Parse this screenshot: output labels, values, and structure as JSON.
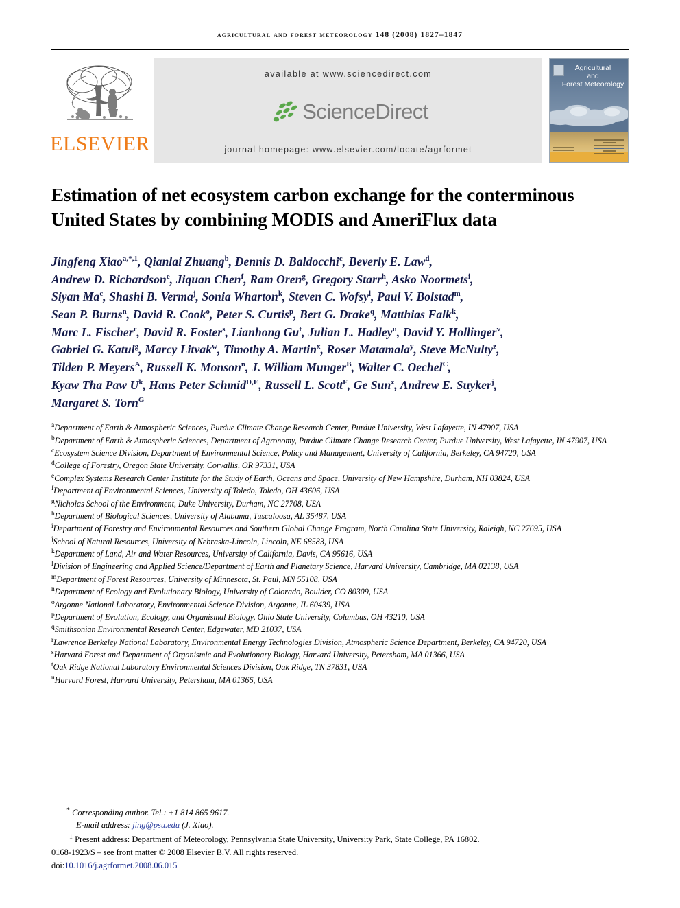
{
  "running_head": "Agricultural and Forest Meteorology 148 (2008) 1827–1847",
  "header": {
    "publisher_name": "ELSEVIER",
    "publisher_logo_icon": "elsevier-tree-icon",
    "available_at": "available at www.sciencedirect.com",
    "sciencedirect_wordmark": "ScienceDirect",
    "sciencedirect_leaves_icon": "sciencedirect-leaves-icon",
    "journal_homepage": "journal homepage: www.elsevier.com/locate/agrformet",
    "cover": {
      "line1": "Agricultural",
      "line2": "and",
      "line3": "Forest Meteorology",
      "badge_icon": "journal-emblem-icon"
    }
  },
  "article": {
    "title": "Estimation of net ecosystem carbon exchange for the conterminous United States by combining MODIS and AmeriFlux data",
    "author_lines": [
      [
        {
          "name": "Jingfeng Xiao",
          "sup": "a,*,1"
        },
        {
          "name": "Qianlai Zhuang",
          "sup": "b"
        },
        {
          "name": "Dennis D. Baldocchi",
          "sup": "c"
        },
        {
          "name": "Beverly E. Law",
          "sup": "d"
        }
      ],
      [
        {
          "name": "Andrew D. Richardson",
          "sup": "e"
        },
        {
          "name": "Jiquan Chen",
          "sup": "f"
        },
        {
          "name": "Ram Oren",
          "sup": "g"
        },
        {
          "name": "Gregory Starr",
          "sup": "h"
        },
        {
          "name": "Asko Noormets",
          "sup": "i"
        }
      ],
      [
        {
          "name": "Siyan Ma",
          "sup": "c"
        },
        {
          "name": "Shashi B. Verma",
          "sup": "j"
        },
        {
          "name": "Sonia Wharton",
          "sup": "k"
        },
        {
          "name": "Steven C. Wofsy",
          "sup": "l"
        },
        {
          "name": "Paul V. Bolstad",
          "sup": "m"
        }
      ],
      [
        {
          "name": "Sean P. Burns",
          "sup": "n"
        },
        {
          "name": "David R. Cook",
          "sup": "o"
        },
        {
          "name": "Peter S. Curtis",
          "sup": "p"
        },
        {
          "name": "Bert G. Drake",
          "sup": "q"
        },
        {
          "name": "Matthias Falk",
          "sup": "k"
        }
      ],
      [
        {
          "name": "Marc L. Fischer",
          "sup": "r"
        },
        {
          "name": "David R. Foster",
          "sup": "s"
        },
        {
          "name": "Lianhong Gu",
          "sup": "t"
        },
        {
          "name": "Julian L. Hadley",
          "sup": "u"
        },
        {
          "name": "David Y. Hollinger",
          "sup": "v"
        }
      ],
      [
        {
          "name": "Gabriel G. Katul",
          "sup": "g"
        },
        {
          "name": "Marcy Litvak",
          "sup": "w"
        },
        {
          "name": "Timothy A. Martin",
          "sup": "x"
        },
        {
          "name": "Roser Matamala",
          "sup": "y"
        },
        {
          "name": "Steve McNulty",
          "sup": "z"
        }
      ],
      [
        {
          "name": "Tilden P. Meyers",
          "sup": "A"
        },
        {
          "name": "Russell K. Monson",
          "sup": "n"
        },
        {
          "name": "J. William Munger",
          "sup": "B"
        },
        {
          "name": "Walter C. Oechel",
          "sup": "C"
        }
      ],
      [
        {
          "name": "Kyaw Tha Paw U",
          "sup": "k"
        },
        {
          "name": "Hans Peter Schmid",
          "sup": "D,E"
        },
        {
          "name": "Russell L. Scott",
          "sup": "F"
        },
        {
          "name": "Ge Sun",
          "sup": "z"
        },
        {
          "name": "Andrew E. Suyker",
          "sup": "j"
        }
      ],
      [
        {
          "name": "Margaret S. Torn",
          "sup": "G",
          "last": true
        }
      ]
    ],
    "affiliations": [
      {
        "mark": "a",
        "text": "Department of Earth & Atmospheric Sciences, Purdue Climate Change Research Center, Purdue University, West Lafayette, IN 47907, USA"
      },
      {
        "mark": "b",
        "text": "Department of Earth & Atmospheric Sciences, Department of Agronomy, Purdue Climate Change Research Center, Purdue University, West Lafayette, IN 47907, USA"
      },
      {
        "mark": "c",
        "text": "Ecosystem Science Division, Department of Environmental Science, Policy and Management, University of California, Berkeley, CA 94720, USA"
      },
      {
        "mark": "d",
        "text": "College of Forestry, Oregon State University, Corvallis, OR 97331, USA"
      },
      {
        "mark": "e",
        "text": "Complex Systems Research Center Institute for the Study of Earth, Oceans and Space, University of New Hampshire, Durham, NH 03824, USA"
      },
      {
        "mark": "f",
        "text": "Department of Environmental Sciences, University of Toledo, Toledo, OH 43606, USA"
      },
      {
        "mark": "g",
        "text": "Nicholas School of the Environment, Duke University, Durham, NC 27708, USA"
      },
      {
        "mark": "h",
        "text": "Department of Biological Sciences, University of Alabama, Tuscaloosa, AL 35487, USA"
      },
      {
        "mark": "i",
        "text": "Department of Forestry and Environmental Resources and Southern Global Change Program, North Carolina State University, Raleigh, NC 27695, USA"
      },
      {
        "mark": "j",
        "text": "School of Natural Resources, University of Nebraska-Lincoln, Lincoln, NE 68583, USA"
      },
      {
        "mark": "k",
        "text": "Department of Land, Air and Water Resources, University of California, Davis, CA 95616, USA"
      },
      {
        "mark": "l",
        "text": "Division of Engineering and Applied Science/Department of Earth and Planetary Science, Harvard University, Cambridge, MA 02138, USA"
      },
      {
        "mark": "m",
        "text": "Department of Forest Resources, University of Minnesota, St. Paul, MN 55108, USA"
      },
      {
        "mark": "n",
        "text": "Department of Ecology and Evolutionary Biology, University of Colorado, Boulder, CO 80309, USA"
      },
      {
        "mark": "o",
        "text": "Argonne National Laboratory, Environmental Science Division, Argonne, IL 60439, USA"
      },
      {
        "mark": "p",
        "text": "Department of Evolution, Ecology, and Organismal Biology, Ohio State University, Columbus, OH 43210, USA"
      },
      {
        "mark": "q",
        "text": "Smithsonian Environmental Research Center, Edgewater, MD 21037, USA"
      },
      {
        "mark": "r",
        "text": "Lawrence Berkeley National Laboratory, Environmental Energy Technologies Division, Atmospheric Science Department, Berkeley, CA 94720, USA"
      },
      {
        "mark": "s",
        "text": "Harvard Forest and Department of Organismic and Evolutionary Biology, Harvard University, Petersham, MA 01366, USA"
      },
      {
        "mark": "t",
        "text": "Oak Ridge National Laboratory Environmental Sciences Division, Oak Ridge, TN 37831, USA"
      },
      {
        "mark": "u",
        "text": "Harvard Forest, Harvard University, Petersham, MA 01366, USA"
      }
    ]
  },
  "footnotes": {
    "corresponding_mark": "*",
    "corresponding": "Corresponding author. Tel.: +1 814 865 9617.",
    "email_label": "E-mail address:",
    "email": "jing@psu.edu",
    "email_owner": "(J. Xiao).",
    "present_mark": "1",
    "present_address": "Present address: Department of Meteorology, Pennsylvania State University, University Park, State College, PA 16802.",
    "copyright": "0168-1923/$ – see front matter © 2008 Elsevier B.V. All rights reserved.",
    "doi_label": "doi:",
    "doi": "10.1016/j.agrformet.2008.06.015"
  },
  "colors": {
    "author_navy": "#151b4a",
    "elsevier_orange": "#ef7d1a",
    "sciencedirect_gray": "#7d7d7d",
    "sciencedirect_green": "#5aa84b",
    "link_blue": "#2c3fa0",
    "band_gray": "#e6e6e6",
    "cover_blue": "#5b7390"
  }
}
